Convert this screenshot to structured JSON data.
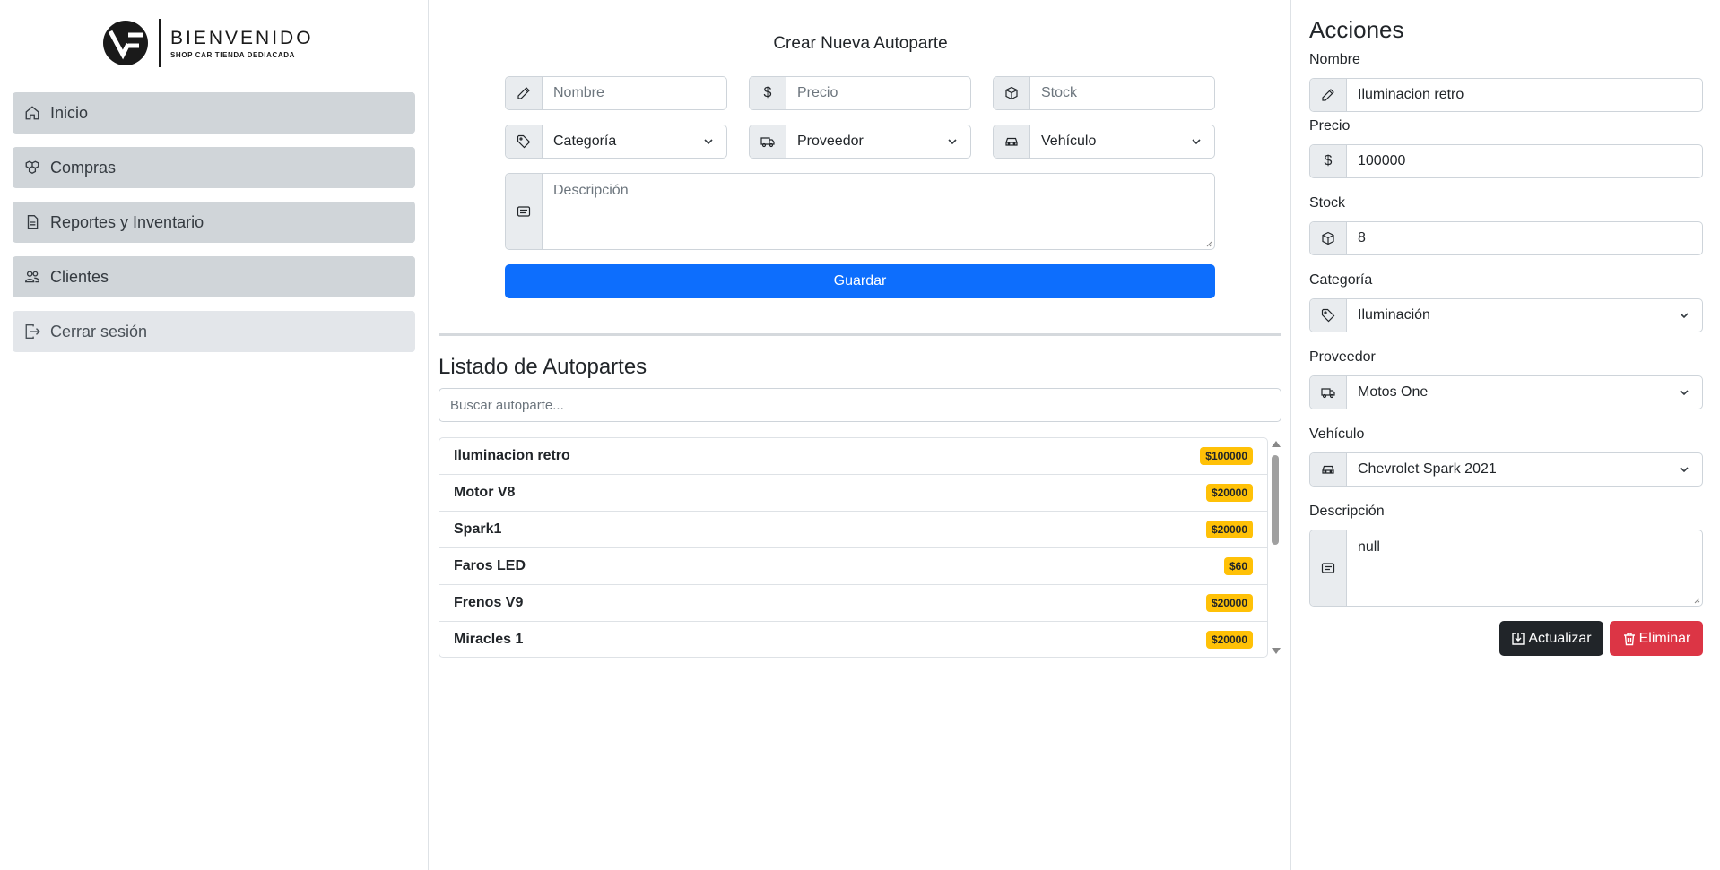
{
  "brand": {
    "title": "BIENVENIDO",
    "subtitle": "SHOP CAR TIENDA DEDIACADA"
  },
  "sidebar": {
    "items": [
      {
        "label": "Inicio",
        "icon": "house-icon"
      },
      {
        "label": "Compras",
        "icon": "boxes-icon"
      },
      {
        "label": "Reportes y Inventario",
        "icon": "file-icon"
      },
      {
        "label": "Clientes",
        "icon": "people-icon"
      },
      {
        "label": "Cerrar sesión",
        "icon": "logout-icon"
      }
    ]
  },
  "create_form": {
    "title": "Crear Nueva Autoparte",
    "nombre_placeholder": "Nombre",
    "precio_placeholder": "Precio",
    "stock_placeholder": "Stock",
    "categoria_value": "Categoría",
    "proveedor_value": "Proveedor",
    "vehiculo_value": "Vehículo",
    "descripcion_placeholder": "Descripción",
    "precio_symbol": "$",
    "save_label": "Guardar"
  },
  "listing": {
    "title": "Listado de Autopartes",
    "search_placeholder": "Buscar autoparte...",
    "items": [
      {
        "name": "Iluminacion retro",
        "price": "$100000"
      },
      {
        "name": "Motor V8",
        "price": "$20000"
      },
      {
        "name": "Spark1",
        "price": "$20000"
      },
      {
        "name": "Faros LED",
        "price": "$60"
      },
      {
        "name": "Frenos V9",
        "price": "$20000"
      },
      {
        "name": "Miracles 1",
        "price": "$20000"
      }
    ]
  },
  "actions": {
    "title": "Acciones",
    "nombre_label": "Nombre",
    "nombre_value": "Iluminacion retro",
    "precio_label": "Precio",
    "precio_symbol": "$",
    "precio_value": "100000",
    "stock_label": "Stock",
    "stock_value": "8",
    "categoria_label": "Categoría",
    "categoria_value": "Iluminación",
    "proveedor_label": "Proveedor",
    "proveedor_value": "Motos One",
    "vehiculo_label": "Vehículo",
    "vehiculo_value": "Chevrolet Spark 2021",
    "descripcion_label": "Descripción",
    "descripcion_value": "null",
    "update_label": "Actualizar",
    "delete_label": "Eliminar"
  },
  "colors": {
    "primary": "#0d6efd",
    "danger": "#dc3545",
    "dark": "#212529",
    "warning": "#ffc107",
    "nav_bg": "#d0d5d9"
  }
}
